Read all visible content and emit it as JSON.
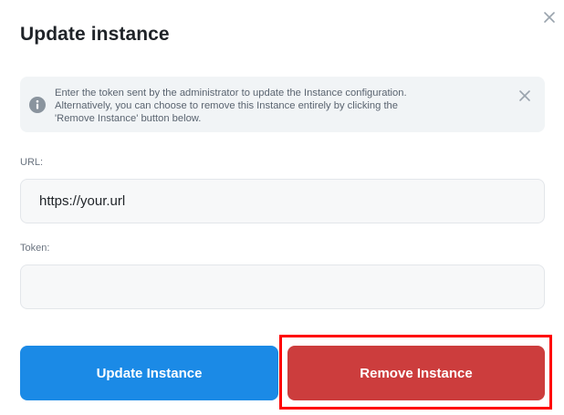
{
  "modal": {
    "title": "Update instance",
    "close_icon": "close-icon"
  },
  "alert": {
    "icon": "info-icon",
    "line1": "Enter the token sent by the administrator to update the Instance configuration.",
    "line2": "Alternatively, you can choose to remove this Instance entirely by clicking the",
    "line3": "'Remove Instance' button below.",
    "close_icon": "close-icon"
  },
  "form": {
    "url_label": "URL:",
    "url_value": "https://your.url",
    "token_label": "Token:",
    "token_value": ""
  },
  "buttons": {
    "update_label": "Update Instance",
    "remove_label": "Remove Instance"
  },
  "colors": {
    "update_button": "#1b8ae6",
    "remove_button": "#cc3d3d",
    "highlight": "#ff0000"
  }
}
